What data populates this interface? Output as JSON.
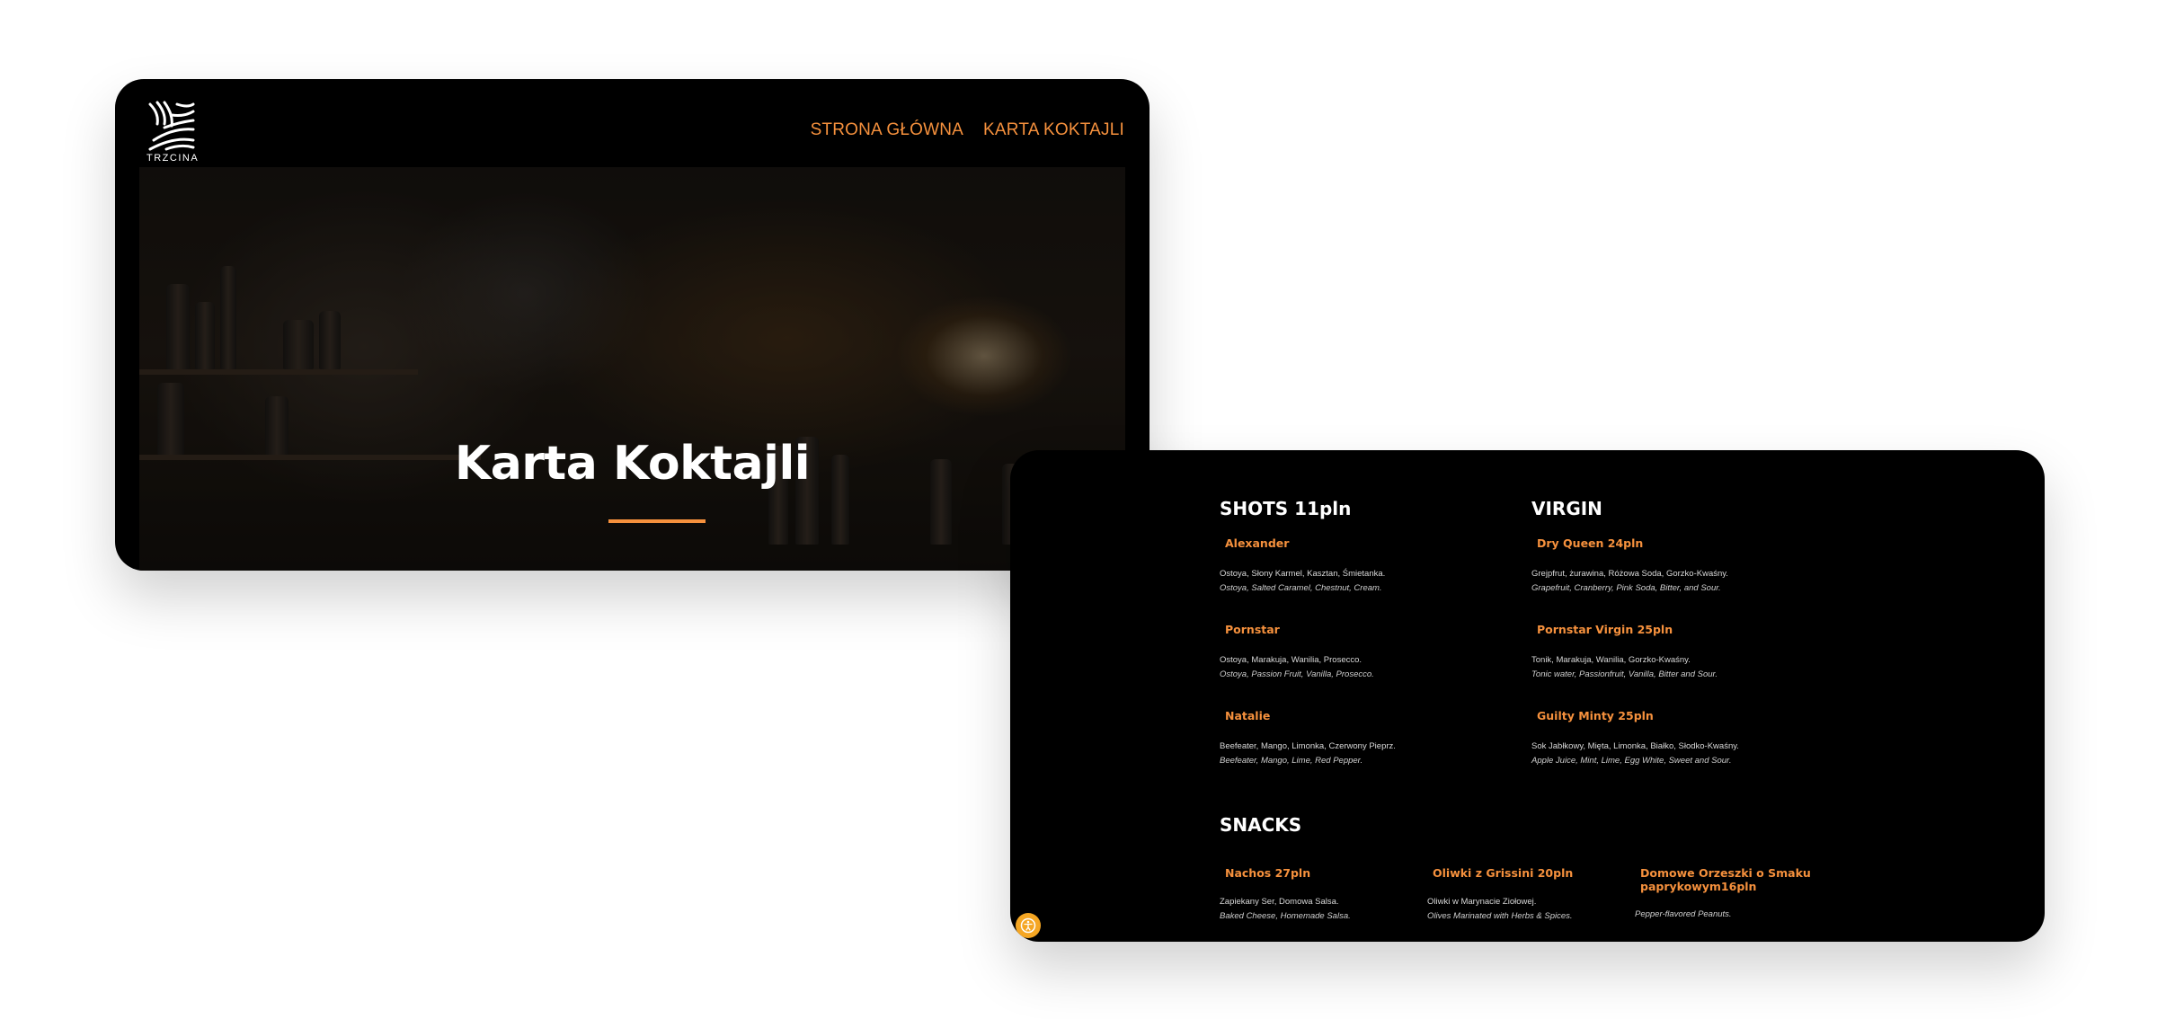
{
  "brand": {
    "logo_text": "TRZCINA"
  },
  "nav": {
    "home": "STRONA GŁÓWNA",
    "cocktails": "KARTA KOKTAJLI"
  },
  "hero": {
    "title": "Karta Koktajli"
  },
  "colors": {
    "accent": "#f6913d",
    "background": "#000000",
    "badge": "#f5a623"
  },
  "menu": {
    "shots": {
      "title": "SHOTS 11pln",
      "items": [
        {
          "name": "Alexander",
          "pl": "Ostoya, Słony Karmel, Kasztan, Śmietanka.",
          "en": "Ostoya, Salted Caramel, Chestnut, Cream."
        },
        {
          "name": "Pornstar",
          "pl": "Ostoya, Marakuja, Wanilia, Prosecco.",
          "en": "Ostoya, Passion Fruit, Vanilla, Prosecco."
        },
        {
          "name": "Natalie",
          "pl": "Beefeater, Mango, Limonka, Czerwony Pieprz.",
          "en": "Beefeater, Mango, Lime, Red Pepper."
        }
      ]
    },
    "virgin": {
      "title": "VIRGIN",
      "items": [
        {
          "name": "Dry Queen 24pln",
          "pl": "Grejpfrut, żurawina, Różowa Soda, Gorzko-Kwaśny.",
          "en": "Grapefruit, Cranberry, Pink Soda, Bitter, and Sour."
        },
        {
          "name": "Pornstar Virgin 25pln",
          "pl": "Tonik, Marakuja, Wanilia, Gorzko-Kwaśny.",
          "en": "Tonic water, Passionfruit, Vanilla, Bitter and Sour."
        },
        {
          "name": "Guilty Minty 25pln",
          "pl": "Sok Jabłkowy, Mięta, Limonka, Białko, Słodko-Kwaśny.",
          "en": "Apple Juice, Mint, Lime, Egg White, Sweet and Sour."
        }
      ]
    },
    "snacks": {
      "title": "SNACKS",
      "items": [
        {
          "name": "Nachos 27pln",
          "pl": "Zapiekany Ser, Domowa Salsa.",
          "en": "Baked Cheese, Homemade Salsa."
        },
        {
          "name": "Oliwki z Grissini 20pln",
          "pl": "Oliwki w Marynacie Ziołowej.",
          "en": "Olives Marinated with Herbs & Spices."
        },
        {
          "name_line1": "Domowe Orzeszki o Smaku",
          "name_line2": "paprykowym16pln",
          "en": "Pepper-flavored Peanuts."
        }
      ]
    }
  },
  "icons": {
    "logo": "reed-logo-icon",
    "badge": "accessibility-icon"
  }
}
